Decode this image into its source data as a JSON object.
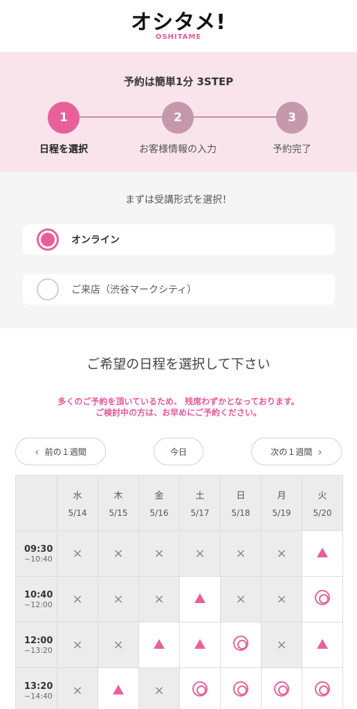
{
  "header": {
    "logo_main": "オシタメ!",
    "logo_sub": "OSHITAME"
  },
  "steps": {
    "title": "予約は簡単1分 3STEP",
    "items": [
      {
        "number": "1",
        "label": "日程を選択",
        "active": true
      },
      {
        "number": "2",
        "label": "お客様情報の入力",
        "active": false
      },
      {
        "number": "3",
        "label": "予約完了",
        "active": false
      }
    ]
  },
  "format": {
    "title": "まずは受講形式を選択！",
    "options": [
      {
        "label": "オンライン",
        "selected": true
      },
      {
        "label": "ご来店（渋谷マークシティ）",
        "selected": false
      }
    ]
  },
  "schedule": {
    "title": "ご希望の日程を選択して下さい",
    "notice_line1": "多くのご予約を頂いているため、 残席わずかとなっております。",
    "notice_line2": "ご検討中の方は、お早めにご予約ください。",
    "prev_label": "前の１週間",
    "today_label": "今日",
    "next_label": "次の１週間",
    "days": [
      {
        "name": "水",
        "date": "5/14"
      },
      {
        "name": "木",
        "date": "5/15"
      },
      {
        "name": "金",
        "date": "5/16"
      },
      {
        "name": "土",
        "date": "5/17"
      },
      {
        "name": "日",
        "date": "5/18"
      },
      {
        "name": "月",
        "date": "5/19"
      },
      {
        "name": "火",
        "date": "5/20"
      }
    ],
    "slots": [
      {
        "start": "09:30",
        "end": "~10:40",
        "cells": [
          "×",
          "×",
          "×",
          "×",
          "×",
          "×",
          "△"
        ]
      },
      {
        "start": "10:40",
        "end": "~12:00",
        "cells": [
          "×",
          "×",
          "×",
          "△",
          "×",
          "×",
          "◎"
        ]
      },
      {
        "start": "12:00",
        "end": "~13:20",
        "cells": [
          "×",
          "×",
          "△",
          "△",
          "◎",
          "×",
          "△"
        ]
      },
      {
        "start": "13:20",
        "end": "~14:40",
        "cells": [
          "×",
          "△",
          "×",
          "◎",
          "◎",
          "◎",
          "◎"
        ]
      }
    ],
    "colors": {
      "accent": "#e8609a",
      "saturday": "#3a8fd6",
      "sunday": "#e8579a"
    }
  }
}
